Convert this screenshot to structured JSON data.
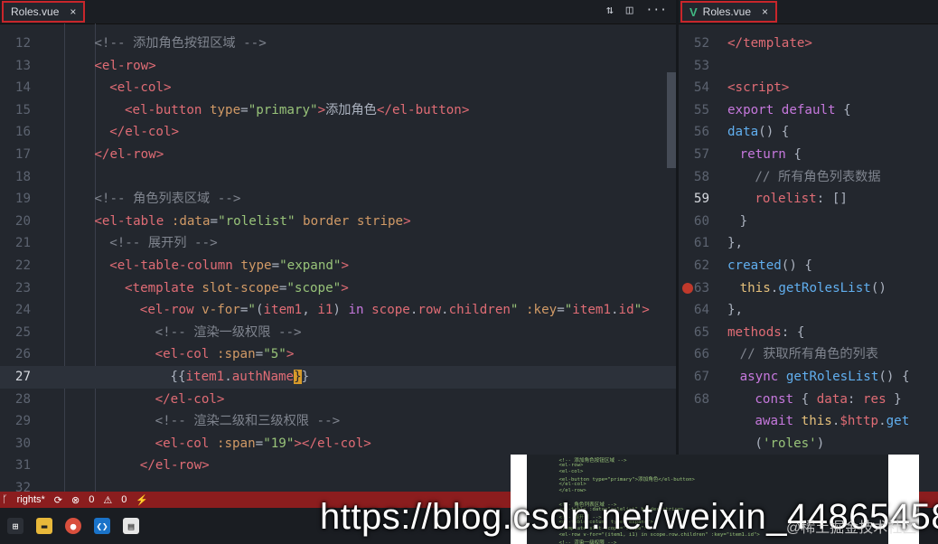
{
  "left_tab": {
    "label": "Roles.vue",
    "close": "×"
  },
  "right_tab": {
    "label": "Roles.vue",
    "close": "×",
    "icon": "V"
  },
  "left_lines": [
    {
      "n": "12",
      "html": "<span class='tk-com'>&lt;!-- 添加角色按钮区域 --&gt;</span>",
      "indent": 6
    },
    {
      "n": "13",
      "html": "<span class='tk-tag'>&lt;el-row&gt;</span>",
      "indent": 6
    },
    {
      "n": "14",
      "html": "<span class='tk-tag'>&lt;el-col&gt;</span>",
      "indent": 8
    },
    {
      "n": "15",
      "html": "<span class='tk-tag'>&lt;el-button</span> <span class='tk-attr'>type</span>=<span class='tk-str'>\"primary\"</span><span class='tk-tag'>&gt;</span>添加角色<span class='tk-tag'>&lt;/el-button&gt;</span>",
      "indent": 10
    },
    {
      "n": "16",
      "html": "<span class='tk-tag'>&lt;/el-col&gt;</span>",
      "indent": 8
    },
    {
      "n": "17",
      "html": "<span class='tk-tag'>&lt;/el-row&gt;</span>",
      "indent": 6
    },
    {
      "n": "18",
      "html": "",
      "indent": 0
    },
    {
      "n": "19",
      "html": "<span class='tk-com'>&lt;!-- 角色列表区域 --&gt;</span>",
      "indent": 6
    },
    {
      "n": "20",
      "html": "<span class='tk-tag'>&lt;el-table</span> <span class='tk-attr'>:data</span>=<span class='tk-str'>\"rolelist\"</span> <span class='tk-attr'>border</span> <span class='tk-attr'>stripe</span><span class='tk-tag'>&gt;</span>",
      "indent": 6
    },
    {
      "n": "21",
      "html": "<span class='tk-com'>&lt;!-- 展开列 --&gt;</span>",
      "indent": 8
    },
    {
      "n": "22",
      "html": "<span class='tk-tag'>&lt;el-table-column</span> <span class='tk-attr'>type</span>=<span class='tk-str'>\"expand\"</span><span class='tk-tag'>&gt;</span>",
      "indent": 8
    },
    {
      "n": "23",
      "html": "<span class='tk-tag'>&lt;template</span> <span class='tk-attr'>slot-scope</span>=<span class='tk-str'>\"scope\"</span><span class='tk-tag'>&gt;</span>",
      "indent": 10
    },
    {
      "n": "24",
      "html": "<span class='tk-tag'>&lt;el-row</span> <span class='tk-attr'>v-for</span>=<span class='tk-str'>\"</span><span class='tk-plain'>(</span><span class='tk-prop'>item1</span>, <span class='tk-prop'>i1</span>) <span class='tk-kw'>in</span> <span class='tk-prop'>scope</span>.<span class='tk-prop'>row</span>.<span class='tk-prop'>children</span><span class='tk-str'>\"</span> <span class='tk-attr'>:key</span>=<span class='tk-str'>\"</span><span class='tk-prop'>item1</span>.<span class='tk-prop'>id</span><span class='tk-str'>\"</span><span class='tk-tag'>&gt;</span>",
      "indent": 12
    },
    {
      "n": "25",
      "html": "<span class='tk-com'>&lt;!-- 渲染一级权限 --&gt;</span>",
      "indent": 14
    },
    {
      "n": "26",
      "html": "<span class='tk-tag'>&lt;el-col</span> <span class='tk-attr'>:span</span>=<span class='tk-str'>\"5\"</span><span class='tk-tag'>&gt;</span>",
      "indent": 14
    },
    {
      "n": "27",
      "html": "<span class='tk-plain'>{</span><span class='tk-plain'>{</span><span class='tk-prop'>item1</span>.<span class='tk-prop'>authName</span><span class='tk-brace'>}</span><span class='tk-plain'>}</span>",
      "indent": 16,
      "active": true
    },
    {
      "n": "28",
      "html": "<span class='tk-tag'>&lt;/el-col&gt;</span>",
      "indent": 14
    },
    {
      "n": "29",
      "html": "<span class='tk-com'>&lt;!-- 渲染二级和三级权限 --&gt;</span>",
      "indent": 14
    },
    {
      "n": "30",
      "html": "<span class='tk-tag'>&lt;el-col</span> <span class='tk-attr'>:span</span>=<span class='tk-str'>\"19\"</span><span class='tk-tag'>&gt;&lt;/el-col&gt;</span>",
      "indent": 14
    },
    {
      "n": "31",
      "html": "<span class='tk-tag'>&lt;/el-row&gt;</span>",
      "indent": 12
    },
    {
      "n": "32",
      "html": "",
      "indent": 0
    }
  ],
  "right_lines": [
    {
      "n": "52",
      "html": "<span class='tk-tag'>&lt;/template&gt;</span>",
      "indent": 0
    },
    {
      "n": "53",
      "html": "",
      "indent": 0
    },
    {
      "n": "54",
      "html": "<span class='tk-tag'>&lt;script&gt;</span>",
      "indent": 0
    },
    {
      "n": "55",
      "html": "<span class='tk-kw'>export</span> <span class='tk-kw'>default</span> {",
      "indent": 0
    },
    {
      "n": "56",
      "html": "<span class='tk-fn'>data</span>() {",
      "indent": 2
    },
    {
      "n": "57",
      "html": "<span class='tk-kw'>return</span> {",
      "indent": 4
    },
    {
      "n": "58",
      "html": "<span class='tk-com'>// 所有角色列表数据</span>",
      "indent": 6
    },
    {
      "n": "59",
      "html": "<span class='tk-prop'>rolelist</span>: []",
      "indent": 6,
      "bright": true
    },
    {
      "n": "60",
      "html": "}",
      "indent": 4
    },
    {
      "n": "61",
      "html": "},",
      "indent": 2
    },
    {
      "n": "62",
      "html": "<span class='tk-fn'>created</span>() {",
      "indent": 2
    },
    {
      "n": "63",
      "html": "<span class='tk-this'>this</span>.<span class='tk-fn'>getRolesList</span>()",
      "indent": 4
    },
    {
      "n": "64",
      "html": "},",
      "indent": 2
    },
    {
      "n": "65",
      "html": "<span class='tk-prop'>methods</span>: {",
      "indent": 2
    },
    {
      "n": "66",
      "html": "<span class='tk-com'>// 获取所有角色的列表</span>",
      "indent": 4
    },
    {
      "n": "67",
      "html": "<span class='tk-kw'>async</span> <span class='tk-fn'>getRolesList</span>() {",
      "indent": 4
    },
    {
      "n": "68",
      "html": "<span class='tk-kw'>const</span> { <span class='tk-prop'>data</span>: <span class='tk-prop'>res</span> }",
      "indent": 6
    },
    {
      "n": "",
      "html": "<span class='tk-kw'>await</span> <span class='tk-this'>this</span>.<span class='tk-prop'>$http</span>.<span class='tk-fn'>get</span>",
      "indent": 6
    },
    {
      "n": "",
      "html": "(<span class='tk-str'>'roles'</span>)",
      "indent": 6
    }
  ],
  "status": {
    "branch": "rights*",
    "errors": "0",
    "warnings": "0"
  },
  "watermark": "https://blog.csdn.net/weixin_44865458",
  "watermark_small": "@稀土掘金技术社区"
}
